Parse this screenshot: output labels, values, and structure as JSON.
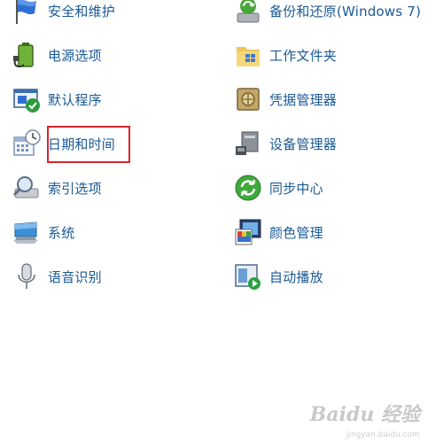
{
  "left_column": [
    {
      "label": "安全和维护",
      "icon": "flag-icon"
    },
    {
      "label": "电源选项",
      "icon": "battery-plug-icon"
    },
    {
      "label": "默认程序",
      "icon": "default-programs-icon"
    },
    {
      "label": "日期和时间",
      "icon": "calendar-clock-icon"
    },
    {
      "label": "索引选项",
      "icon": "magnifier-drive-icon"
    },
    {
      "label": "系统",
      "icon": "monitor-icon"
    },
    {
      "label": "语音识别",
      "icon": "microphone-icon"
    }
  ],
  "right_column": [
    {
      "label": "备份和还原(Windows 7)",
      "icon": "backup-icon"
    },
    {
      "label": "工作文件夹",
      "icon": "work-folder-icon"
    },
    {
      "label": "凭据管理器",
      "icon": "vault-icon"
    },
    {
      "label": "设备管理器",
      "icon": "device-manager-icon"
    },
    {
      "label": "同步中心",
      "icon": "sync-icon"
    },
    {
      "label": "颜色管理",
      "icon": "color-management-icon"
    },
    {
      "label": "自动播放",
      "icon": "autoplay-icon"
    }
  ],
  "highlight_target": "日期和时间",
  "watermark": {
    "text": "Baidu 经验",
    "url": "jingyan.baidu.com"
  },
  "colors": {
    "link": "#1a5a96",
    "highlight": "#d9232e"
  }
}
